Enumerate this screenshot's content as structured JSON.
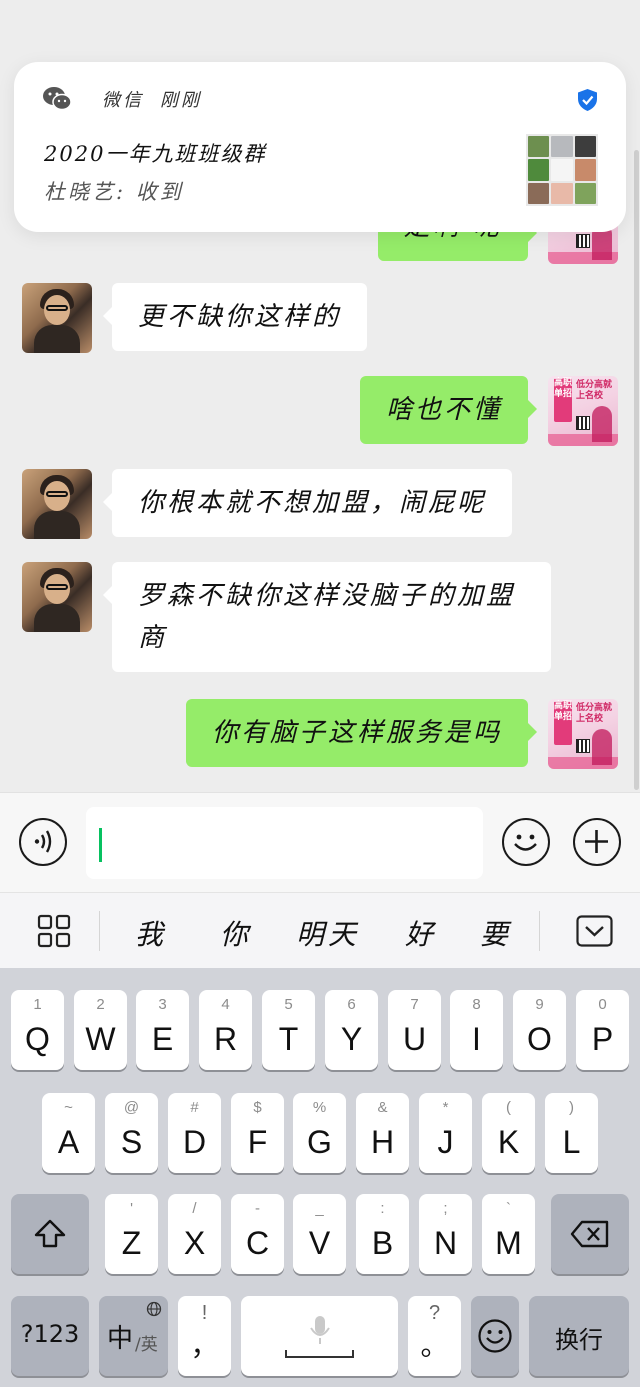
{
  "notification": {
    "app_name": "微信",
    "time": "刚刚",
    "title": "2020一年九班班级群",
    "preview": "杜晓艺: 收到",
    "colors": {
      "verified": "#1a73e8"
    }
  },
  "chat": {
    "partial_top_message": "是啊 呢",
    "messages": [
      {
        "side": "in",
        "text": "更不缺你这样的"
      },
      {
        "side": "out",
        "text": "啥也不懂"
      },
      {
        "side": "in",
        "text": "你根本就不想加盟，闹屁呢"
      },
      {
        "side": "in",
        "text_line1": "罗森不缺你这样没脑子的加盟",
        "text_line2": "商"
      },
      {
        "side": "out",
        "text": "你有脑子这样服务是吗"
      }
    ],
    "self_avatar": {
      "band_text": "高职单招",
      "side_text": "低分高就上名校"
    },
    "colors": {
      "out_bubble": "#95ec69",
      "in_bubble": "#ffffff",
      "background": "#ededed"
    }
  },
  "input": {
    "value": "",
    "caret_color": "#07c160"
  },
  "candidates": [
    "我",
    "你",
    "明天",
    "好",
    "要"
  ],
  "keyboard": {
    "row1": [
      {
        "k": "Q",
        "n": "1"
      },
      {
        "k": "W",
        "n": "2"
      },
      {
        "k": "E",
        "n": "3"
      },
      {
        "k": "R",
        "n": "4"
      },
      {
        "k": "T",
        "n": "5"
      },
      {
        "k": "Y",
        "n": "6"
      },
      {
        "k": "U",
        "n": "7"
      },
      {
        "k": "I",
        "n": "8"
      },
      {
        "k": "O",
        "n": "9"
      },
      {
        "k": "P",
        "n": "0"
      }
    ],
    "row2": [
      {
        "k": "A",
        "n": "~"
      },
      {
        "k": "S",
        "n": "@"
      },
      {
        "k": "D",
        "n": "#"
      },
      {
        "k": "F",
        "n": "$"
      },
      {
        "k": "G",
        "n": "%"
      },
      {
        "k": "H",
        "n": "&"
      },
      {
        "k": "J",
        "n": "*"
      },
      {
        "k": "K",
        "n": "("
      },
      {
        "k": "L",
        "n": ")"
      }
    ],
    "row3": [
      {
        "k": "Z",
        "n": "'"
      },
      {
        "k": "X",
        "n": "/"
      },
      {
        "k": "C",
        "n": "-"
      },
      {
        "k": "V",
        "n": "_"
      },
      {
        "k": "B",
        "n": ":"
      },
      {
        "k": "N",
        "n": ";"
      },
      {
        "k": "M",
        "n": "`"
      }
    ],
    "numbers_label": "?123",
    "lang_main": "中",
    "lang_sub": "/英",
    "comma_top": "!",
    "comma_main": "，",
    "period_top": "?",
    "period_main": "。",
    "enter_label": "换行"
  }
}
